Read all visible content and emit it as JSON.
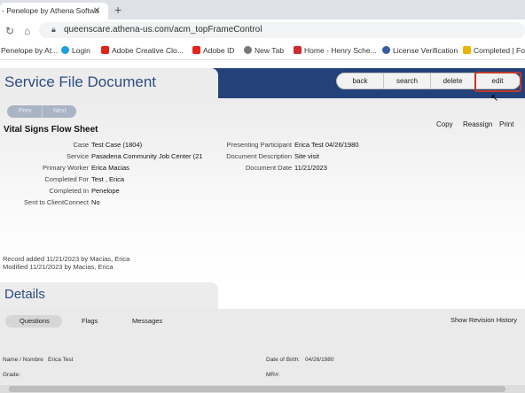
{
  "browser": {
    "tab_title": "- Penelope by Athena Softwa",
    "url": "queenscare.athena-us.com/acm_topFrameControl",
    "bookmarks": [
      {
        "label": "Penelope by At...",
        "icon": "penelope-icon",
        "color": "#3b5ba9"
      },
      {
        "label": "Login",
        "icon": "salesforce-cloud-icon",
        "color": "#1ea0e0"
      },
      {
        "label": "Adobe Creative Clo...",
        "icon": "adobe-icon",
        "color": "#e1251b"
      },
      {
        "label": "Adobe ID",
        "icon": "adobe-icon",
        "color": "#e1251b"
      },
      {
        "label": "New Tab",
        "icon": "globe-icon",
        "color": "#555555"
      },
      {
        "label": "Home - Henry Sche...",
        "icon": "henry-schein-icon",
        "color": "#d22b2b"
      },
      {
        "label": "License Verification",
        "icon": "license-icon",
        "color": "#3b5ba9"
      },
      {
        "label": "Completed | Forms",
        "icon": "download-icon",
        "color": "#e8b400"
      }
    ]
  },
  "page": {
    "title": "Service File Document",
    "toolbar": {
      "back": "back",
      "search": "search",
      "delete": "delete",
      "edit": "edit"
    },
    "prev": "Prev",
    "next": "Next",
    "doc_title": "Vital Signs Flow Sheet",
    "actions": {
      "copy": "Copy",
      "reassign": "Reassign",
      "print": "Print"
    },
    "left_fields": [
      {
        "label": "Case",
        "value": "Test  Case (1804)"
      },
      {
        "label": "Service",
        "value": "Pasadena Community Job Center  (21"
      },
      {
        "label": "Primary Worker",
        "value": "Erica  Macias"
      },
      {
        "label": "Completed For",
        "value": "Test , Erica"
      },
      {
        "label": "Completed In",
        "value": "Penelope"
      },
      {
        "label": "Sent to ClientConnect",
        "value": "No"
      }
    ],
    "right_fields": [
      {
        "label": "Presenting Participant",
        "value": "Erica  Test  04/26/1980"
      },
      {
        "label": "Document Description",
        "value": "Site visit"
      },
      {
        "label": "Document Date",
        "value": "11/21/2023"
      }
    ],
    "record_added": "Record added 11/21/2023 by Macias, Erica",
    "modified": "Modified 11/21/2023 by Macias, Erica"
  },
  "details": {
    "title": "Details",
    "tabs": {
      "questions": "Questions",
      "flags": "Flags",
      "messages": "Messages"
    },
    "revision": "Show Revision History",
    "name_label": "Name / Nombre",
    "name_value": "Erica  Test",
    "dob_label": "Date of Birth:",
    "dob_value": "04/26/1980",
    "grade_label": "Grade:",
    "mr_label": "MR#:"
  },
  "colors": {
    "brand_blue": "#23427a",
    "title_blue": "#2d4d82",
    "highlight_red": "#c0392b"
  }
}
